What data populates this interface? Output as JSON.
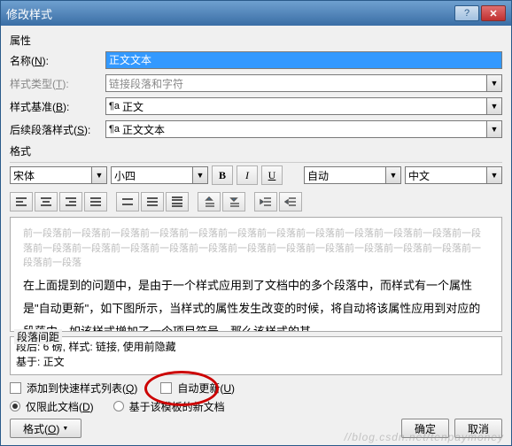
{
  "title": "修改样式",
  "props_label": "属性",
  "name_label": "名称(N):",
  "name_value": "正文文本",
  "type_label": "样式类型(T):",
  "type_value": "链接段落和字符",
  "base_label": "样式基准(B):",
  "base_value": "正文",
  "follow_label": "后续段落样式(S):",
  "follow_value": "正文文本",
  "format_label": "格式",
  "font_value": "宋体",
  "size_value": "小四",
  "auto_value": "自动",
  "lang_value": "中文",
  "ghost_text": "前一段落前一段落前一段落前一段落前一段落前一段落前一段落前一段落前一段落前一段落前一段落前一段落前一段落前一段落前一段落前一段落前一段落前一段落前一段落前一段落前一段落前一段落前一段落前一段落前一段落",
  "preview_text": "在上面提到的问题中，是由于一个样式应用到了文档中的多个段落中，而样式有一个属性是\"自动更新\"，如下图所示，当样式的属性发生改变的时候，将自动将该属性应用到对应的段落中。如该样式增加了一个项目符号，那么该样式的其",
  "desc_legend": "段落间距",
  "desc_line1": "段后: 6 磅, 样式: 链接, 使用前隐藏",
  "desc_line2": "基于: 正文",
  "quick_label": "添加到快速样式列表(Q)",
  "autoupdate_label": "自动更新(U)",
  "radio1_label": "仅限此文档(D)",
  "radio2_label": "基于该模板的新文档",
  "format_btn": "格式(O)",
  "ok_btn": "确定",
  "cancel_btn": "取消",
  "watermark": "//blog.csdn.net/tenpaymoney",
  "pilcrow": "¶a"
}
